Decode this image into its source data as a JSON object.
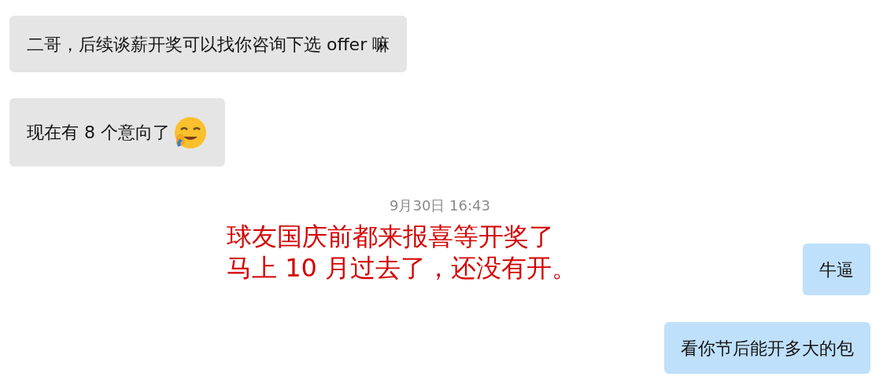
{
  "received": [
    {
      "text": "二哥，后续谈薪开奖可以找你咨询下选 offer 嘛",
      "emoji": false
    },
    {
      "text": "现在有 8 个意向了",
      "emoji": true
    }
  ],
  "timestamp": "9月30日 16:43",
  "annotation": [
    "球友国庆前都来报喜等开奖了",
    "马上 10 月过去了，还没有开。"
  ],
  "sent": [
    {
      "text": "牛逼"
    },
    {
      "text": "看你节后能开多大的包"
    }
  ]
}
